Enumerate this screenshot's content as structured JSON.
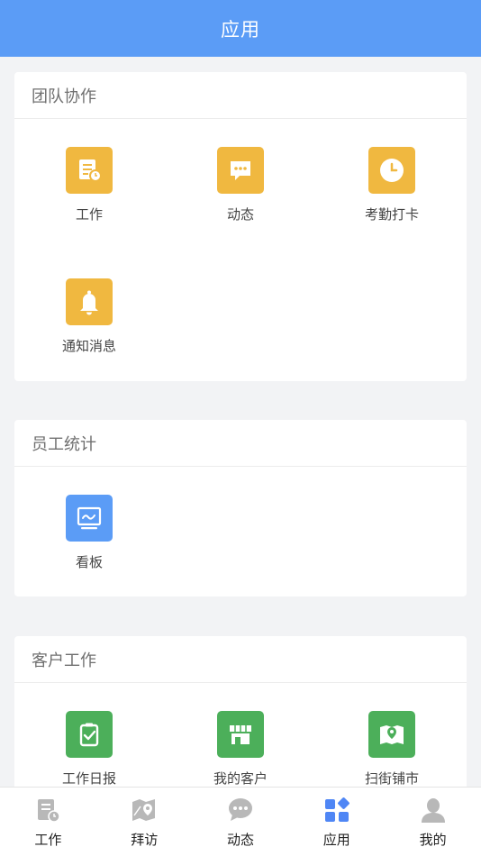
{
  "header": {
    "title": "应用"
  },
  "colors": {
    "primary": "#5b9cf6",
    "yellow": "#f0b840",
    "blue": "#5b9cf6",
    "green": "#4caf5a",
    "inactive": "#b8b8b8"
  },
  "sections": [
    {
      "title": "团队协作",
      "apps": [
        {
          "label": "工作",
          "icon": "work-doc-icon"
        },
        {
          "label": "动态",
          "icon": "chat-bubble-icon"
        },
        {
          "label": "考勤打卡",
          "icon": "clock-icon"
        },
        {
          "label": "通知消息",
          "icon": "bell-icon"
        }
      ]
    },
    {
      "title": "员工统计",
      "apps": [
        {
          "label": "看板",
          "icon": "dashboard-monitor-icon"
        }
      ]
    },
    {
      "title": "客户工作",
      "apps": [
        {
          "label": "工作日报",
          "icon": "clipboard-check-icon"
        },
        {
          "label": "我的客户",
          "icon": "store-icon"
        },
        {
          "label": "扫街铺市",
          "icon": "map-pin-icon"
        }
      ]
    }
  ],
  "tabbar": [
    {
      "label": "工作",
      "icon": "work-doc-icon",
      "active": false
    },
    {
      "label": "拜访",
      "icon": "map-visit-icon",
      "active": false
    },
    {
      "label": "动态",
      "icon": "chat-bubble-icon",
      "active": false
    },
    {
      "label": "应用",
      "icon": "apps-grid-icon",
      "active": true
    },
    {
      "label": "我的",
      "icon": "person-icon",
      "active": false
    }
  ]
}
